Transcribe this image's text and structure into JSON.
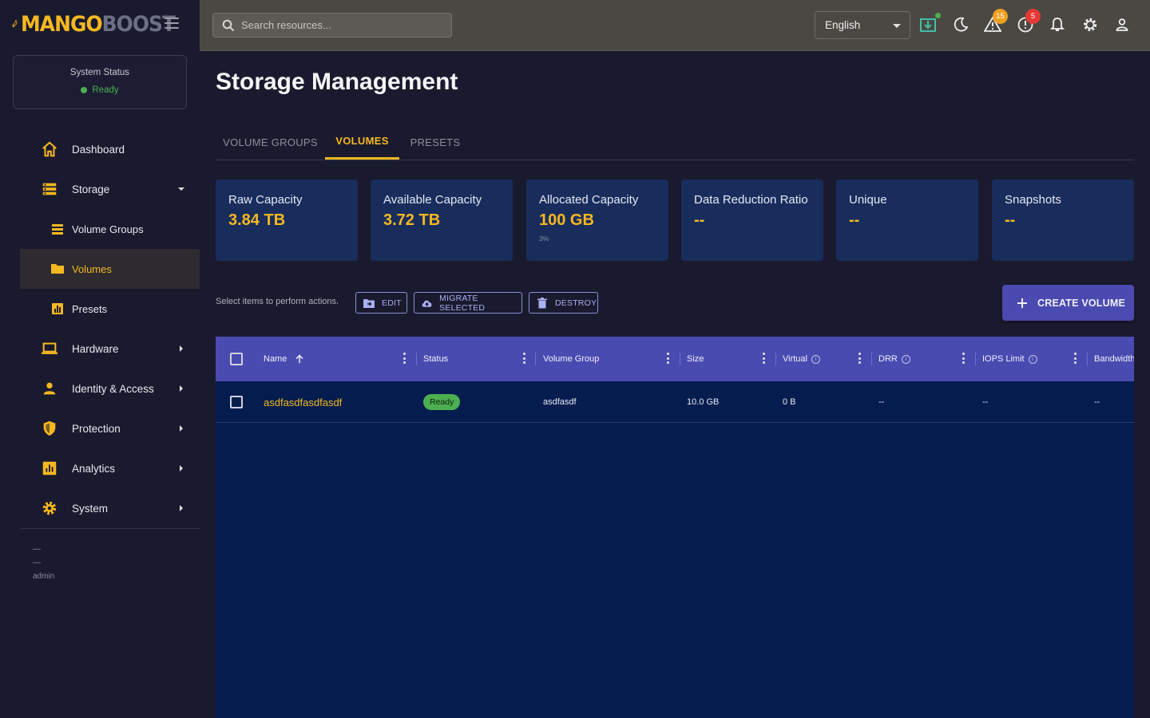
{
  "brand": {
    "name_a": "MANGO",
    "name_b": "BOOST",
    "accent": "#f5b820"
  },
  "system_status": {
    "title": "System Status",
    "state": "Ready",
    "state_color": "#4caf50"
  },
  "sidebar": {
    "items": [
      {
        "label": "Dashboard",
        "icon": "home-icon"
      },
      {
        "label": "Storage",
        "icon": "storage-icon",
        "expanded": true
      },
      {
        "label": "Volume Groups",
        "icon": "list-icon"
      },
      {
        "label": "Volumes",
        "icon": "folder-icon",
        "active": true
      },
      {
        "label": "Presets",
        "icon": "chart-icon"
      },
      {
        "label": "Hardware",
        "icon": "laptop-icon"
      },
      {
        "label": "Identity & Access",
        "icon": "person-icon"
      },
      {
        "label": "Protection",
        "icon": "shield-icon"
      },
      {
        "label": "Analytics",
        "icon": "analytics-icon"
      },
      {
        "label": "System",
        "icon": "gear-icon"
      }
    ],
    "user": {
      "line1": "—",
      "line2": "—",
      "role": "admin"
    }
  },
  "topbar": {
    "search_placeholder": "Search resources...",
    "language": "English",
    "warnings_count": "15",
    "errors_count": "5",
    "warn_color": "#f0a020",
    "error_color": "#e53935"
  },
  "page": {
    "title": "Storage Management",
    "tabs": [
      {
        "label": "VOLUME GROUPS"
      },
      {
        "label": "VOLUMES",
        "active": true
      },
      {
        "label": "PRESETS"
      }
    ]
  },
  "cards": [
    {
      "label": "Raw Capacity",
      "value": "3.84 TB"
    },
    {
      "label": "Available Capacity",
      "value": "3.72 TB"
    },
    {
      "label": "Allocated Capacity",
      "value": "100 GB",
      "note": "3%"
    },
    {
      "label": "Data Reduction Ratio",
      "value": "--"
    },
    {
      "label": "Unique",
      "value": "--"
    },
    {
      "label": "Snapshots",
      "value": "--"
    }
  ],
  "actions": {
    "hint": "Select items to perform actions.",
    "edit": "EDIT",
    "migrate": "MIGRATE SELECTED",
    "destroy": "DESTROY",
    "create": "CREATE VOLUME"
  },
  "table": {
    "columns": [
      "Name",
      "Status",
      "Volume Group",
      "Size",
      "Virtual",
      "DRR",
      "IOPS Limit",
      "Bandwidth"
    ],
    "rows": [
      {
        "name": "asdfasdfasdfasdf",
        "status": "Ready",
        "volume_group": "asdfasdf",
        "size": "10.0 GB",
        "virtual": "0 B",
        "drr": "--",
        "iops": "--",
        "bandwidth": "--"
      }
    ]
  }
}
